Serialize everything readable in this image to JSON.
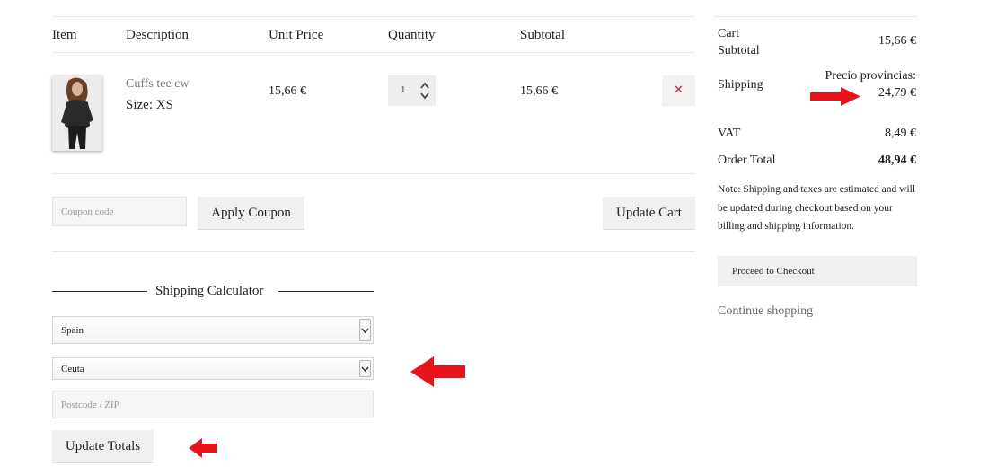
{
  "cart_table": {
    "headers": [
      "Item",
      "Description",
      "Unit Price",
      "Quantity",
      "Subtotal"
    ],
    "item": {
      "name": "Cuffs tee cw",
      "size_label": "Size:",
      "size_value": "XS",
      "unit_price": "15,66 €",
      "quantity": "1",
      "subtotal": "15,66 €",
      "remove_glyph": "✕"
    }
  },
  "coupon": {
    "placeholder": "Coupon code",
    "apply_label": "Apply Coupon"
  },
  "update_cart_label": "Update Cart",
  "shipping_calculator": {
    "title": "Shipping Calculator",
    "country": "Spain",
    "region": "Ceuta",
    "postcode_placeholder": "Postcode / ZIP",
    "update_totals_label": "Update Totals"
  },
  "summary": {
    "cart_subtotal_label_line1": "Cart",
    "cart_subtotal_label_line2": "Subtotal",
    "cart_subtotal_value": "15,66 €",
    "shipping_label": "Shipping",
    "shipping_method": "Precio provincias:",
    "shipping_value": "24,79 €",
    "vat_label": "VAT",
    "vat_value": "8,49 €",
    "order_total_label": "Order Total",
    "order_total_value": "48,94 €",
    "note": "Note: Shipping and taxes are estimated and will be updated during checkout based on your billing and shipping information.",
    "checkout_label": "Proceed to Checkout",
    "continue_label": "Continue shopping"
  },
  "annotation_color": "#e8141b",
  "icons": [
    "remove-icon",
    "quantity-stepper-arrows-icon",
    "select-arrow-icon",
    "red-arrow-icon",
    "product-thumbnail"
  ]
}
